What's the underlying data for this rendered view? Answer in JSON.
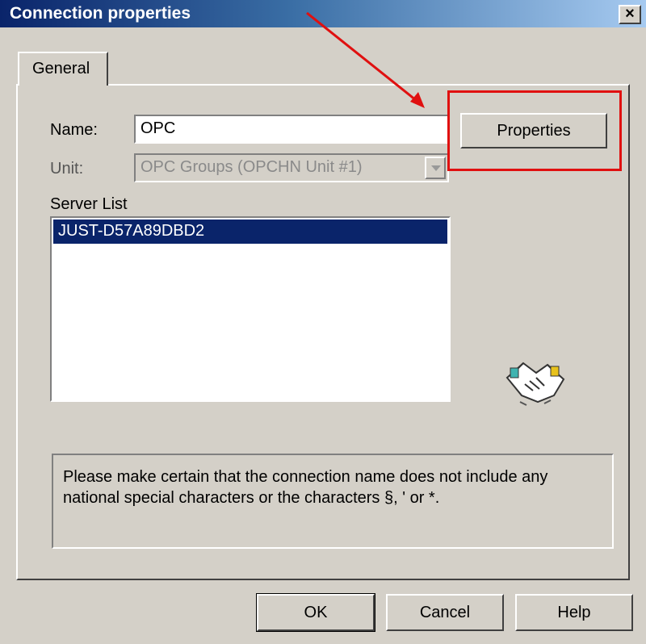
{
  "window": {
    "title": "Connection properties",
    "close_label": "×"
  },
  "tabs": [
    {
      "label": "General"
    }
  ],
  "form": {
    "name_label": "Name:",
    "name_value": "OPC",
    "unit_label": "Unit:",
    "unit_value": "OPC Groups (OPCHN Unit #1)",
    "properties_button": "Properties",
    "server_list_label": "Server List",
    "server_list_items": [
      "JUST-D57A89DBD2"
    ]
  },
  "notice": "Please make certain that the connection name does not include any national special characters or the characters §, ' or *.",
  "buttons": {
    "ok": "OK",
    "cancel": "Cancel",
    "help": "Help"
  },
  "annotation": {
    "color": "#e01010"
  },
  "icons": [
    "handshake-icon",
    "close-icon",
    "dropdown-arrow-icon"
  ]
}
